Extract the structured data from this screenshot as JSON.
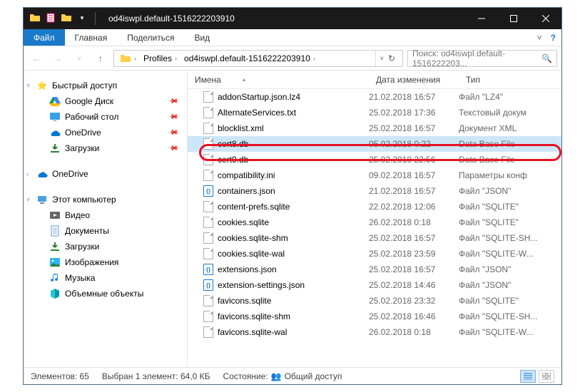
{
  "window": {
    "title": "od4iswpl.default-1516222203910"
  },
  "tabs": {
    "file": "Файл",
    "home": "Главная",
    "share": "Поделиться",
    "view": "Вид"
  },
  "breadcrumbs": [
    "Profiles",
    "od4iswpl.default-1516222203910"
  ],
  "search": {
    "placeholder": "Поиск: od4iswpl.default-1516222203..."
  },
  "nav": {
    "quick": {
      "label": "Быстрый доступ",
      "items": [
        {
          "icon": "gdrive",
          "label": "Google Диск"
        },
        {
          "icon": "desktop",
          "label": "Рабочий стол"
        },
        {
          "icon": "onedrive",
          "label": "OneDrive"
        },
        {
          "icon": "downloads",
          "label": "Загрузки"
        }
      ]
    },
    "onedrive": {
      "label": "OneDrive"
    },
    "pc": {
      "label": "Этот компьютер",
      "items": [
        {
          "icon": "video",
          "label": "Видео"
        },
        {
          "icon": "docs",
          "label": "Документы"
        },
        {
          "icon": "downloads",
          "label": "Загрузки"
        },
        {
          "icon": "pictures",
          "label": "Изображения"
        },
        {
          "icon": "music",
          "label": "Музыка"
        },
        {
          "icon": "3d",
          "label": "Объемные объекты"
        }
      ]
    }
  },
  "columns": {
    "name": "Имена",
    "date": "Дата изменения",
    "type": "Тип"
  },
  "files": [
    {
      "icon": "doc",
      "name": "addonStartup.json.lz4",
      "date": "21.02.2018 16:57",
      "type": "Файл \"LZ4\""
    },
    {
      "icon": "doc",
      "name": "AlternateServices.txt",
      "date": "25.02.2018 17:36",
      "type": "Текстовый докум"
    },
    {
      "icon": "doc",
      "name": "blocklist.xml",
      "date": "25.02.2018 16:57",
      "type": "Документ XML"
    },
    {
      "icon": "doc",
      "name": "cert8.db",
      "date": "05.02.2018 0:22",
      "type": "Data Base File",
      "selected": true
    },
    {
      "icon": "doc",
      "name": "cert9.db",
      "date": "25.02.2018 22:56",
      "type": "Data Base File"
    },
    {
      "icon": "doc",
      "name": "compatibility.ini",
      "date": "09.02.2018 16:57",
      "type": "Параметры конф"
    },
    {
      "icon": "json",
      "name": "containers.json",
      "date": "21.02.2018 16:57",
      "type": "Файл \"JSON\""
    },
    {
      "icon": "doc",
      "name": "content-prefs.sqlite",
      "date": "22.02.2018 12:06",
      "type": "Файл \"SQLITE\""
    },
    {
      "icon": "doc",
      "name": "cookies.sqlite",
      "date": "26.02.2018 0:18",
      "type": "Файл \"SQLITE\""
    },
    {
      "icon": "doc",
      "name": "cookies.sqlite-shm",
      "date": "25.02.2018 16:57",
      "type": "Файл \"SQLITE-SH..."
    },
    {
      "icon": "doc",
      "name": "cookies.sqlite-wal",
      "date": "25.02.2018 23:59",
      "type": "Файл \"SQLITE-W..."
    },
    {
      "icon": "json",
      "name": "extensions.json",
      "date": "25.02.2018 16:57",
      "type": "Файл \"JSON\""
    },
    {
      "icon": "json",
      "name": "extension-settings.json",
      "date": "25.02.2018 14:46",
      "type": "Файл \"JSON\""
    },
    {
      "icon": "doc",
      "name": "favicons.sqlite",
      "date": "25.02.2018 23:32",
      "type": "Файл \"SQLITE\""
    },
    {
      "icon": "doc",
      "name": "favicons.sqlite-shm",
      "date": "25.02.2018 16:46",
      "type": "Файл \"SQLITE-SH..."
    },
    {
      "icon": "doc",
      "name": "favicons.sqlite-wal",
      "date": "26.02.2018 0:18",
      "type": "Файл \"SQLITE-W..."
    }
  ],
  "status": {
    "count_label": "Элементов:",
    "count": "65",
    "sel_label": "Выбран 1 элемент:",
    "sel_size": "64,0 КБ",
    "state_label": "Состояние:",
    "state": "Общий доступ"
  }
}
